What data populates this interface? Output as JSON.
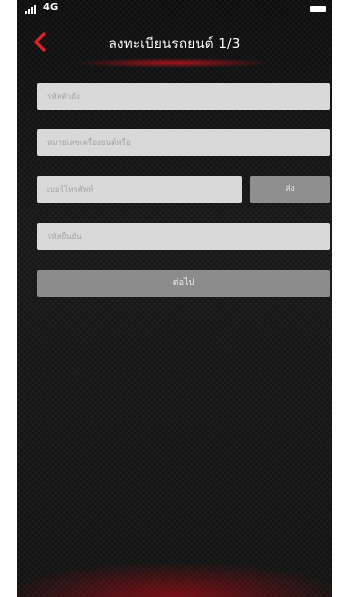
{
  "status_bar": {
    "network": "4G"
  },
  "header": {
    "title": "ลงทะเบียนรถยนต์ 1/3"
  },
  "form": {
    "code_placeholder": "รหัสตัวถัง",
    "engine_placeholder": "หมายเลขเครื่องยนต์หรือ",
    "phone_placeholder": "เบอร์โทรศัพท์",
    "send_label": "ส่ง",
    "otp_placeholder": "รหัสยืนยัน",
    "next_label": "ต่อไป"
  },
  "colors": {
    "accent": "#e0202a",
    "background": "#141414",
    "field": "#d9d9d9",
    "button": "#8c8c8c"
  }
}
